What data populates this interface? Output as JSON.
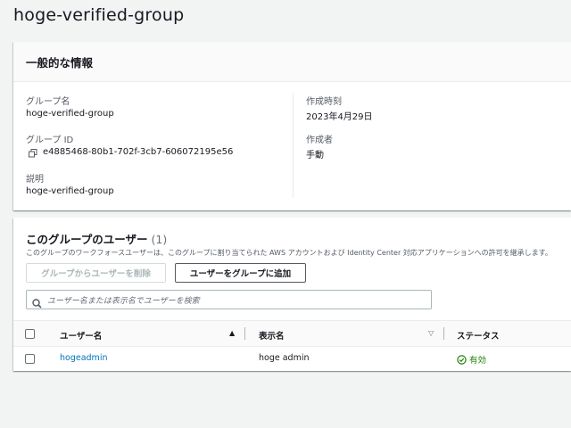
{
  "page": {
    "title": "hoge-verified-group"
  },
  "general": {
    "header": "一般的な情報",
    "group_name_label": "グループ名",
    "group_name_value": "hoge-verified-group",
    "group_id_label": "グループ ID",
    "group_id_value": "e4885468-80b1-702f-3cb7-606072195e56",
    "description_label": "説明",
    "description_value": "hoge-verified-group",
    "created_at_label": "作成時刻",
    "created_at_value": "2023年4月29日",
    "created_by_label": "作成者",
    "created_by_value": "手動"
  },
  "users": {
    "title": "このグループのユーザー",
    "count": "(1)",
    "description": "このグループのワークフォースユーザーは、このグループに割り当てられた AWS アカウントおよび Identity Center 対応アプリケーションへの許可を継承します。",
    "remove_button": "グループからユーザーを削除",
    "add_button": "ユーザーをグループに追加",
    "search_placeholder": "ユーザー名または表示名でユーザーを検索",
    "columns": {
      "username": "ユーザー名",
      "display_name": "表示名",
      "status": "ステータス"
    },
    "rows": [
      {
        "username": "hogeadmin",
        "display_name": "hoge admin",
        "status": "有効"
      }
    ]
  },
  "colors": {
    "link": "#0073bb",
    "status_active": "#1d8102",
    "background": "#f2f3f3"
  },
  "icons": {
    "copy": "copy-icon",
    "search": "search-icon",
    "sort_asc": "sort-ascending-icon",
    "sort_none": "sort-descending-icon",
    "status": "check-circle-icon"
  }
}
